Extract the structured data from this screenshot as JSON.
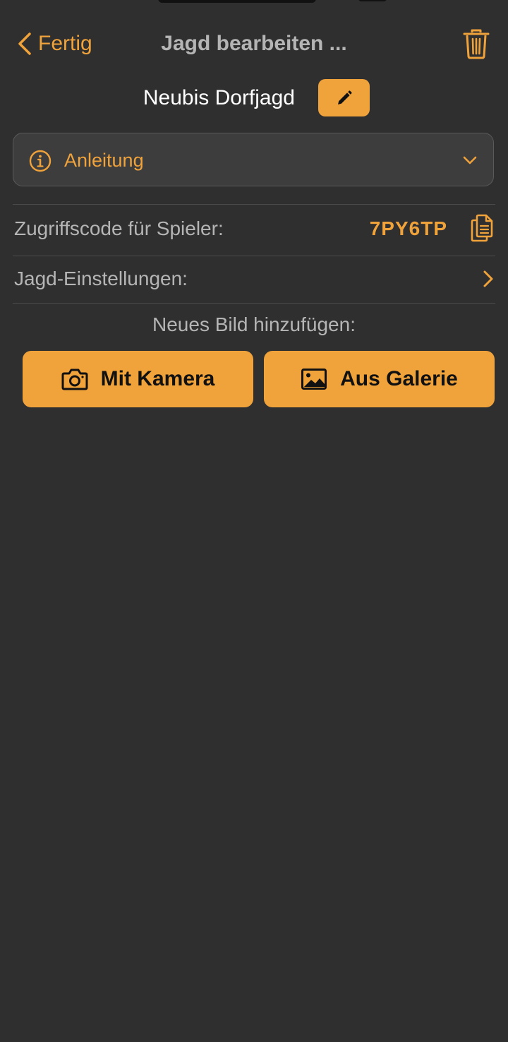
{
  "nav": {
    "back_label": "Fertig",
    "title": "Jagd bearbeiten ...",
    "back_icon": "chevron-left-icon",
    "trash_icon": "trash-icon"
  },
  "hunt": {
    "name": "Neubis Dorfjagd",
    "edit_icon": "pencil-icon"
  },
  "instructions": {
    "label": "Anleitung",
    "icon": "info-icon",
    "expand_icon": "chevron-down-icon"
  },
  "access_code": {
    "label": "Zugriffscode für Spieler:",
    "value": "7PY6TP",
    "copy_icon": "copy-icon"
  },
  "settings": {
    "label": "Jagd-Einstellungen:",
    "icon": "chevron-right-icon"
  },
  "add_image": {
    "label": "Neues Bild hinzufügen:",
    "camera_button": "Mit Kamera",
    "gallery_button": "Aus Galerie",
    "camera_icon": "camera-icon",
    "gallery_icon": "image-icon"
  },
  "colors": {
    "background": "#2f2f2f",
    "accent": "#f0a23b",
    "text_secondary": "#b5b5b5",
    "text_primary": "#ffffff",
    "panel": "#3d3d3d"
  }
}
